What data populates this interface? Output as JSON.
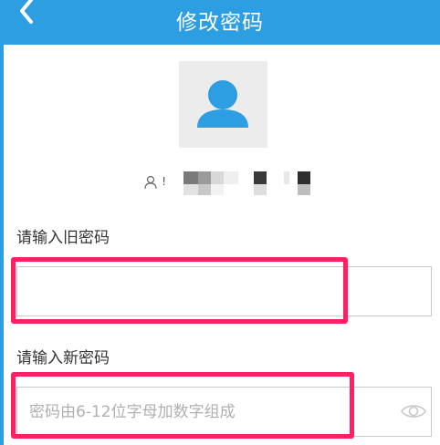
{
  "header": {
    "title": "修改密码",
    "background": "#2e9ee2"
  },
  "user": {
    "id_prefix": "!"
  },
  "old_password": {
    "label": "请输入旧密码",
    "value": "",
    "placeholder": ""
  },
  "new_password": {
    "label": "请输入新密码",
    "value": "",
    "placeholder": "密码由6-12位字母加数字组成"
  },
  "icons": {
    "back": "chevron-left-icon",
    "avatar": "person-avatar-icon",
    "user": "person-outline-icon",
    "eye": "eye-icon"
  },
  "colors": {
    "accent": "#2e9ee2",
    "highlight": "#ff1f63"
  }
}
